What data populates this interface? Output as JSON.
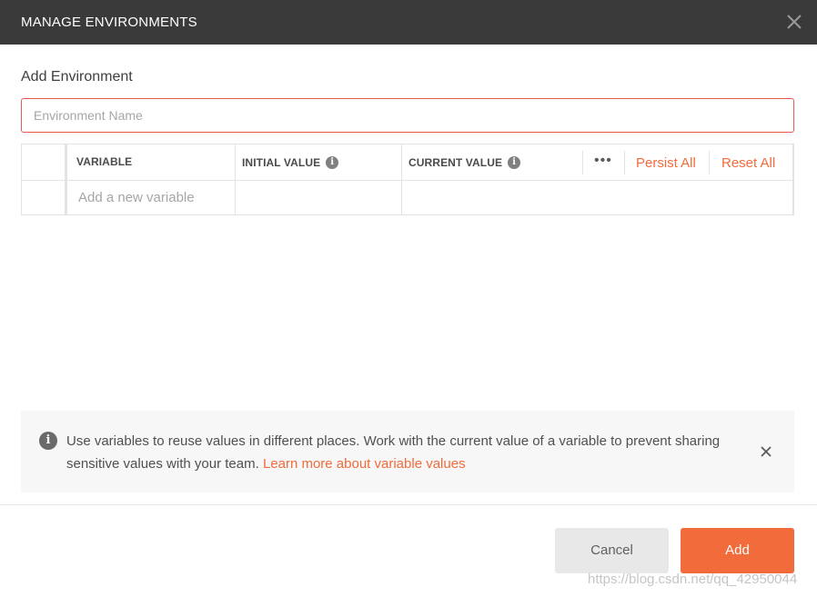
{
  "dialog": {
    "title": "MANAGE ENVIRONMENTS"
  },
  "form": {
    "heading": "Add Environment",
    "name_placeholder": "Environment Name"
  },
  "table": {
    "columns": {
      "variable": "VARIABLE",
      "initial_value": "INITIAL VALUE",
      "current_value": "CURRENT VALUE"
    },
    "more_icon": "ellipsis-icon",
    "persist_all": "Persist All",
    "reset_all": "Reset All",
    "new_variable_placeholder": "Add a new variable"
  },
  "banner": {
    "icon": "info-icon",
    "message": "Use variables to reuse values in different places. Work with the current value of a variable to prevent sharing sensitive values with your team.",
    "learn_more": "Learn more about variable values"
  },
  "footer": {
    "cancel_label": "Cancel",
    "add_label": "Add"
  },
  "watermark": "https://blog.csdn.net/qq_42950044",
  "colors": {
    "titlebar": "#3a3a3a",
    "accent": "#f26b3a",
    "error_border": "#e15b4c"
  }
}
